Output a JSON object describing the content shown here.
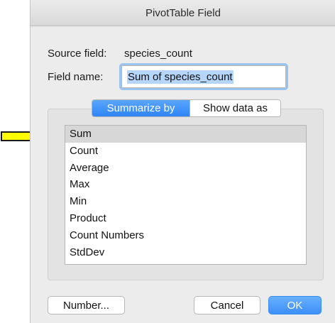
{
  "window": {
    "title": "PivotTable Field"
  },
  "source": {
    "label": "Source field:",
    "value": "species_count"
  },
  "field_name": {
    "label": "Field name:",
    "value": "Sum of species_count"
  },
  "tabs": [
    {
      "label": "Summarize by",
      "active": true
    },
    {
      "label": "Show data as",
      "active": false
    }
  ],
  "functions": [
    {
      "label": "Sum",
      "selected": true
    },
    {
      "label": "Count"
    },
    {
      "label": "Average"
    },
    {
      "label": "Max"
    },
    {
      "label": "Min"
    },
    {
      "label": "Product"
    },
    {
      "label": "Count Numbers"
    },
    {
      "label": "StdDev"
    }
  ],
  "buttons": {
    "number": "Number...",
    "cancel": "Cancel",
    "ok": "OK"
  },
  "colors": {
    "accent": "#3d8ff7",
    "annotation_arrow": "#ffff00"
  }
}
